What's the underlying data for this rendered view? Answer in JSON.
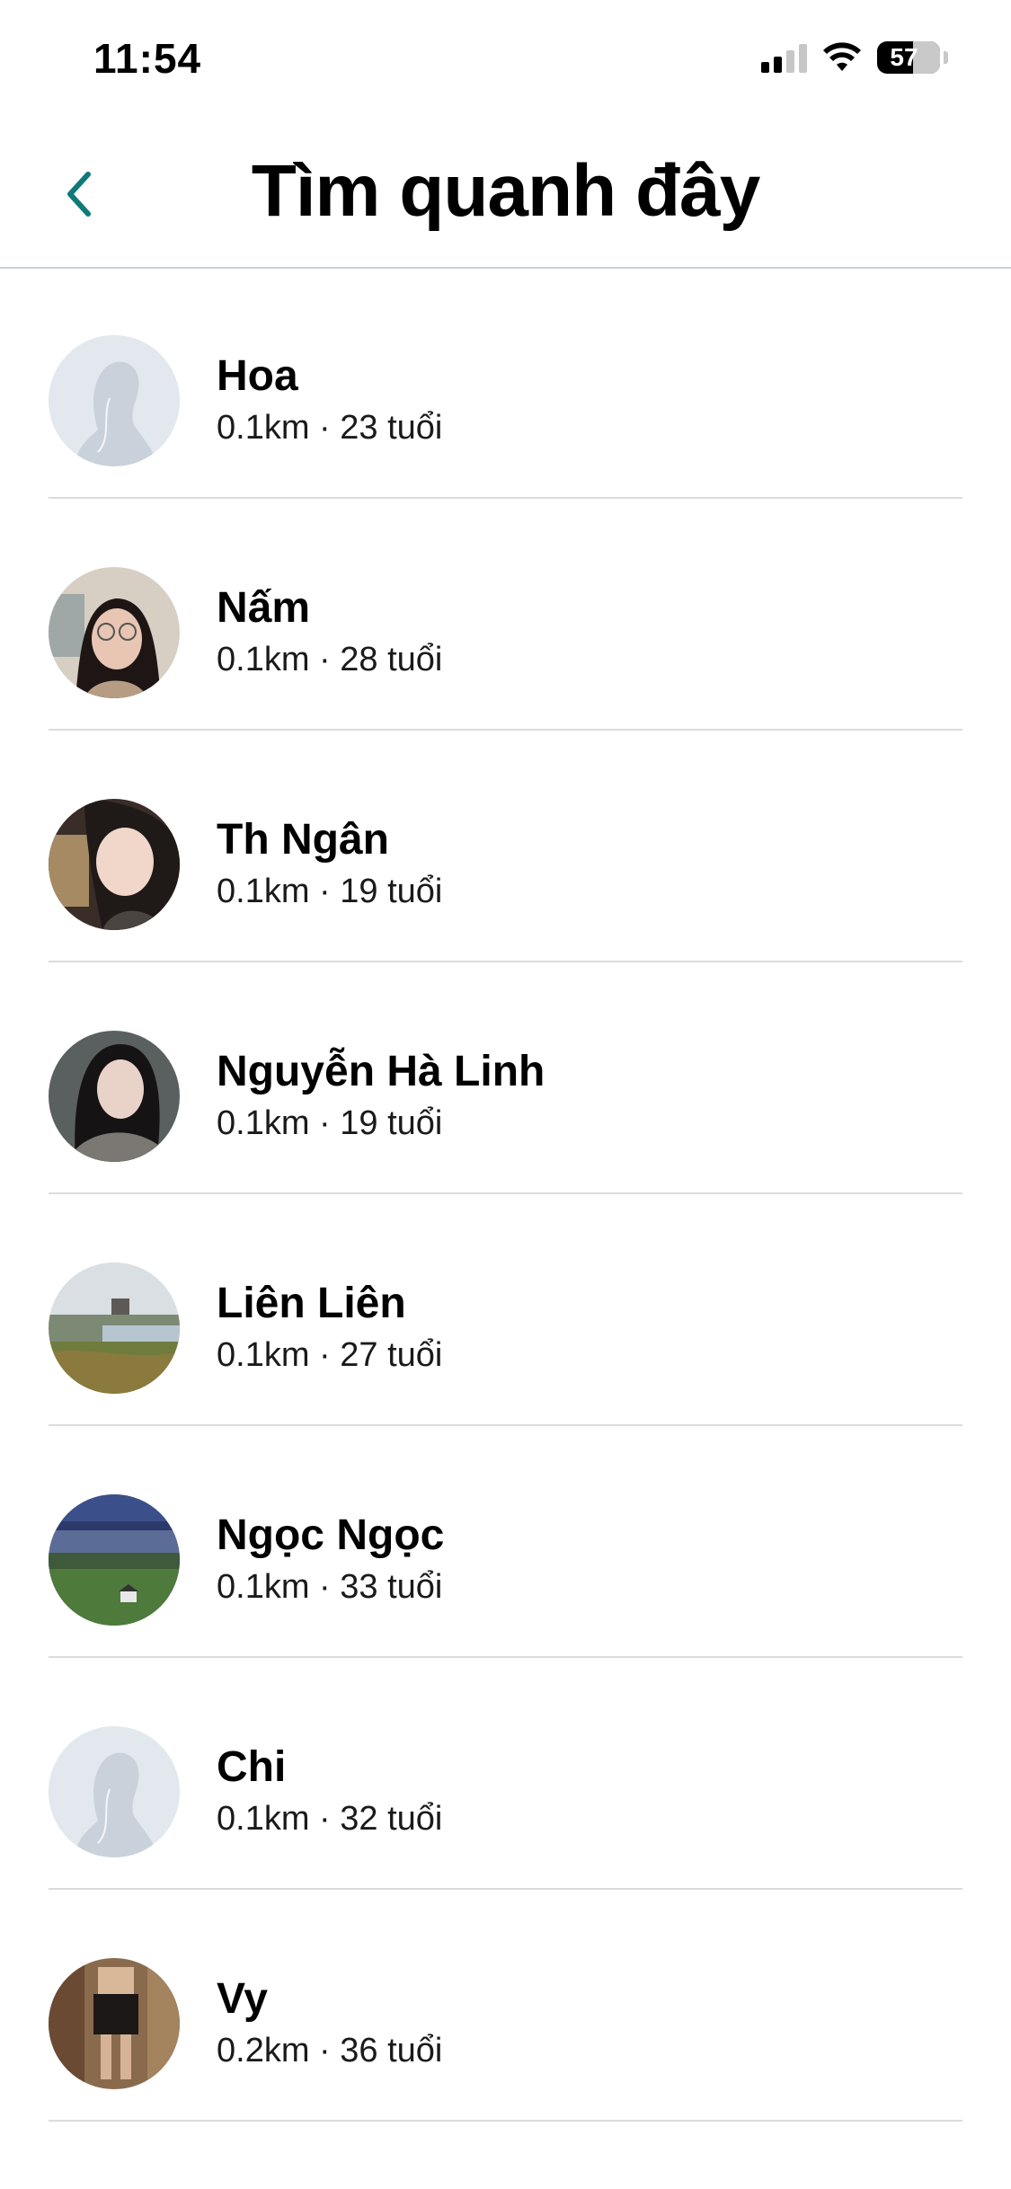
{
  "status_bar": {
    "time": "11:54",
    "battery": "57",
    "icons": [
      "cellular-signal-icon",
      "wifi-icon",
      "battery-icon"
    ]
  },
  "nav": {
    "title": "Tìm quanh đây",
    "back_icon": "chevron-left-icon",
    "accent_color": "#0f7a78"
  },
  "users": [
    {
      "name": "Hoa",
      "meta": "0.1km · 23 tuổi",
      "avatar": "default-avatar"
    },
    {
      "name": "Nấm",
      "meta": "0.1km · 28 tuổi",
      "avatar": "photo-girl-glasses"
    },
    {
      "name": "Th Ngân",
      "meta": "0.1km · 19 tuổi",
      "avatar": "photo-girl-selfie"
    },
    {
      "name": "Nguyễn Hà Linh",
      "meta": "0.1km · 19 tuổi",
      "avatar": "photo-girl-dark"
    },
    {
      "name": "Liên Liên",
      "meta": "0.1km · 27 tuổi",
      "avatar": "photo-lake-landscape"
    },
    {
      "name": "Ngọc Ngọc",
      "meta": "0.1km · 33 tuổi",
      "avatar": "photo-field-landscape"
    },
    {
      "name": "Chi",
      "meta": "0.1km · 32 tuổi",
      "avatar": "default-avatar"
    },
    {
      "name": "Vy",
      "meta": "0.2km · 36 tuổi",
      "avatar": "photo-mirror-selfie"
    }
  ]
}
